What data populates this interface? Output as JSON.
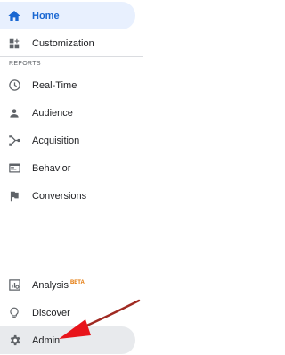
{
  "nav": {
    "primary": [
      {
        "label": "Home",
        "icon": "home-icon"
      },
      {
        "label": "Customization",
        "icon": "customization-icon"
      }
    ],
    "section_label": "REPORTS",
    "reports": [
      {
        "label": "Real-Time",
        "icon": "clock-icon"
      },
      {
        "label": "Audience",
        "icon": "person-icon"
      },
      {
        "label": "Acquisition",
        "icon": "acquisition-icon"
      },
      {
        "label": "Behavior",
        "icon": "behavior-icon"
      },
      {
        "label": "Conversions",
        "icon": "flag-icon"
      }
    ],
    "bottom": [
      {
        "label": "Analysis",
        "badge": "BETA",
        "icon": "analysis-icon"
      },
      {
        "label": "Discover",
        "icon": "lightbulb-icon"
      },
      {
        "label": "Admin",
        "icon": "gear-icon"
      }
    ]
  },
  "colors": {
    "active_bg": "#e8f0fe",
    "active_text": "#1967d2",
    "admin_bg": "#e8eaed",
    "icon": "#5f6368",
    "annotation_arrow": "#e8141b"
  }
}
